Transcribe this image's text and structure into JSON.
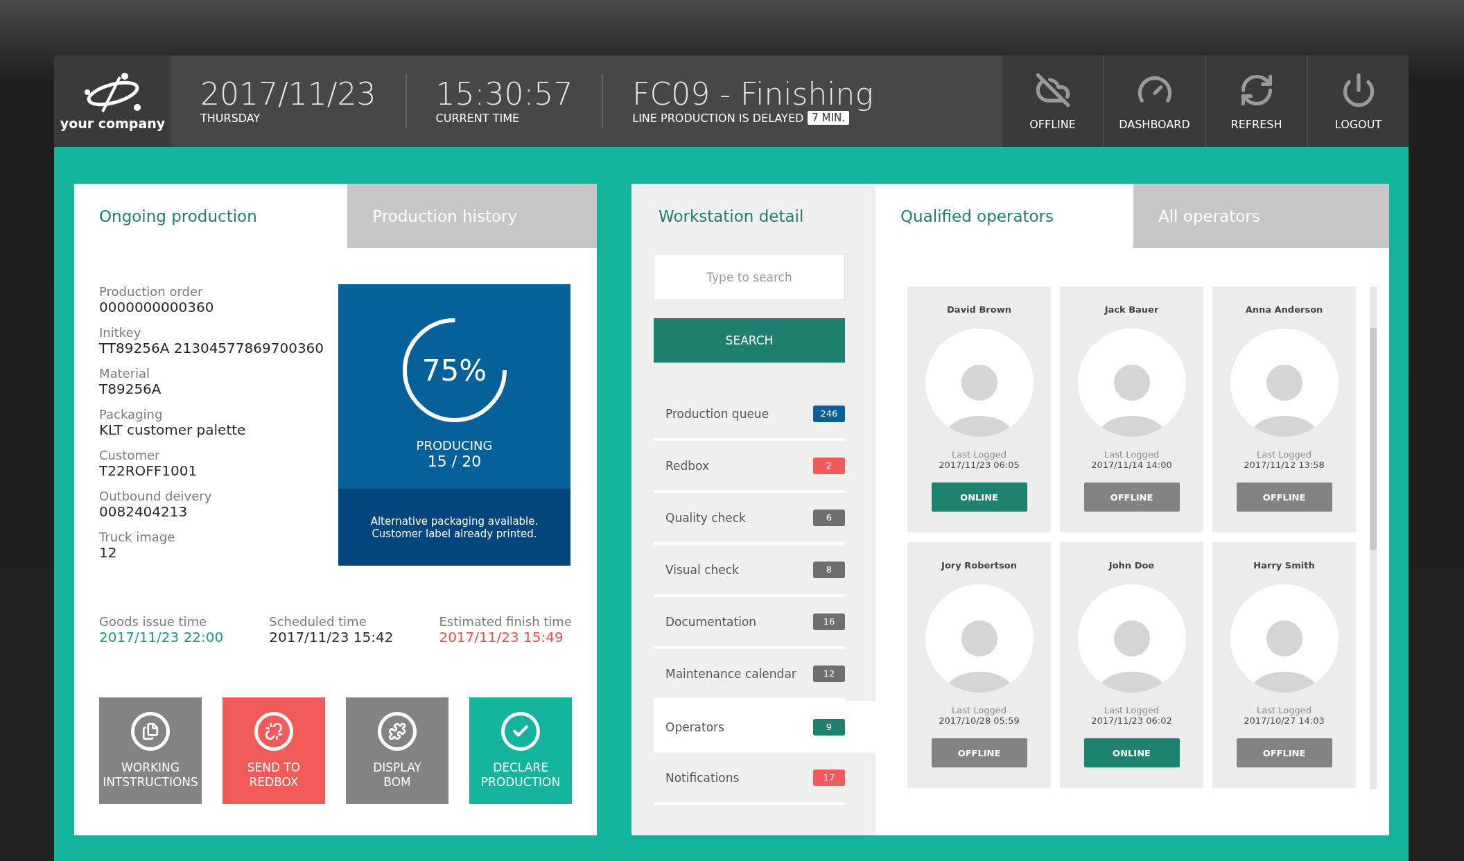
{
  "header": {
    "logo_text": "your company",
    "date": "2017/11/23",
    "day": "THURSDAY",
    "time": "15:30:57",
    "time_label": "CURRENT TIME",
    "station": "FC09 - Finishing",
    "delay_text": "LINE PRODUCTION IS DELAYED",
    "delay_badge": "7 MIN.",
    "buttons": [
      {
        "kind": "offline",
        "label": "OFFLINE"
      },
      {
        "kind": "dashboard",
        "label": "DASHBOARD"
      },
      {
        "kind": "refresh",
        "label": "REFRESH"
      },
      {
        "kind": "logout",
        "label": "LOGOUT"
      }
    ]
  },
  "production": {
    "tabs": [
      {
        "label": "Ongoing production",
        "selected": true
      },
      {
        "label": "Production history",
        "selected": false
      }
    ],
    "fields": [
      {
        "label": "Production order",
        "value": "0000000000360"
      },
      {
        "label": "Initkey",
        "value": "TT89256A 21304577869700360"
      },
      {
        "label": "Material",
        "value": "T89256A"
      },
      {
        "label": "Packaging",
        "value": "KLT customer palette"
      },
      {
        "label": "Customer",
        "value": "T22ROFF1001"
      },
      {
        "label": "Outbound deivery",
        "value": "0082404213"
      },
      {
        "label": "Truck image",
        "value": "12"
      }
    ],
    "progress": {
      "level": 0.75,
      "percent": "75%",
      "status": "PRODUCING",
      "count": "15 / 20",
      "note": "Alternative packaging available.\nCustomer label already printed."
    },
    "times": [
      {
        "label": "Goods issue time",
        "value": "2017/11/23 22:00",
        "color": "#1a9a86"
      },
      {
        "label": "Scheduled time",
        "value": "2017/11/23 15:42",
        "color": "#2b2b2b"
      },
      {
        "label": "Estimated finish time",
        "value": "2017/11/23 15:49",
        "color": "#f0504f"
      }
    ],
    "actions": [
      {
        "kind": "instructions",
        "label": "WORKING\nINTSTRUCTIONS",
        "color": "#838383"
      },
      {
        "kind": "redbox",
        "label": "SEND TO\nREDBOX",
        "color": "#f05a58"
      },
      {
        "kind": "bom",
        "label": "DISPLAY\nBOM",
        "color": "#838383"
      },
      {
        "kind": "declare",
        "label": "DECLARE\nPRODUCTION",
        "color": "#13b49b"
      }
    ]
  },
  "workstation": {
    "title": "Workstation detail",
    "search": {
      "placeholder": "Type to search",
      "button": "SEARCH"
    },
    "items": [
      {
        "label": "Production queue",
        "count": "246",
        "color": "#0c6097",
        "selected": false
      },
      {
        "label": "Redbox",
        "count": "2",
        "color": "#f05a58",
        "selected": false
      },
      {
        "label": "Quality check",
        "count": "6",
        "color": "#6e6e6e",
        "selected": false
      },
      {
        "label": "Visual check",
        "count": "8",
        "color": "#6e6e6e",
        "selected": false
      },
      {
        "label": "Documentation",
        "count": "16",
        "color": "#6e6e6e",
        "selected": false
      },
      {
        "label": "Maintenance calendar",
        "count": "12",
        "color": "#6e6e6e",
        "selected": false
      },
      {
        "label": "Operators",
        "count": "9",
        "color": "#1f7f6e",
        "selected": true
      },
      {
        "label": "Notifications",
        "count": "17",
        "color": "#f05a58",
        "selected": false
      }
    ]
  },
  "operators": {
    "tabs": [
      {
        "label": "Qualified operators",
        "selected": true
      },
      {
        "label": "All operators",
        "selected": false
      }
    ],
    "cards": [
      {
        "name": "David Brown",
        "last_logged_label": "Last Logged",
        "last_logged": "2017/11/23 06:05",
        "online": true,
        "status": "ONLINE"
      },
      {
        "name": "Jack Bauer",
        "last_logged_label": "Last Logged",
        "last_logged": "2017/11/14 14:00",
        "online": false,
        "status": "OFFLINE"
      },
      {
        "name": "Anna Anderson",
        "last_logged_label": "Last Logged",
        "last_logged": "2017/11/12 13:58",
        "online": false,
        "status": "OFFLINE"
      },
      {
        "name": "Jory Robertson",
        "last_logged_label": "Last Logged",
        "last_logged": "2017/10/28 05:59",
        "online": false,
        "status": "OFFLINE"
      },
      {
        "name": "John Doe",
        "last_logged_label": "Last Logged",
        "last_logged": "2017/11/23 06:02",
        "online": true,
        "status": "ONLINE"
      },
      {
        "name": "Harry Smith",
        "last_logged_label": "Last Logged",
        "last_logged": "2017/10/27 14:03",
        "online": false,
        "status": "OFFLINE"
      }
    ]
  }
}
